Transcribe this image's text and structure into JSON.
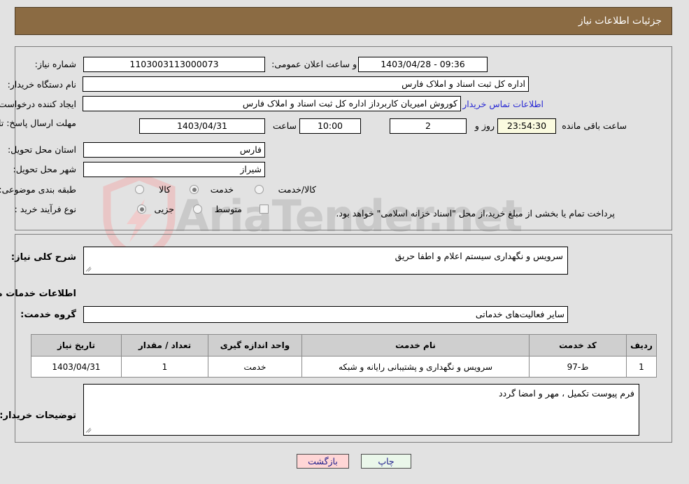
{
  "header": {
    "title": "جزئیات اطلاعات نیاز",
    "bar_color": "#8b6b43"
  },
  "form": {
    "need_number_label": "شماره نیاز:",
    "need_number_value": "1103003113000073",
    "public_announce_label": "تاریخ و ساعت اعلان عمومی:",
    "public_announce_value": "09:36 - 1403/04/28",
    "buyer_org_label": "نام دستگاه خریدار:",
    "buyer_org_value": "اداره کل ثبت اسناد و املاک فارس",
    "requester_label": "ایجاد کننده درخواست:",
    "requester_value": "کوروش امیریان کاربرداز اداره کل ثبت اسناد و املاک فارس",
    "buyer_contact_link": "اطلاعات تماس خریدار",
    "deadline_label": "مهلت ارسال پاسخ: تا تاریخ:",
    "deadline_date": "1403/04/31",
    "hour_label": "ساعت",
    "deadline_time": "10:00",
    "days_remaining": "2",
    "days_word": "روز و",
    "countdown": "23:54:30",
    "countdown_suffix": "ساعت باقی مانده",
    "province_label": "استان محل تحویل:",
    "province_value": "فارس",
    "city_label": "شهر محل تحویل:",
    "city_value": "شیراز",
    "category_label": "طبقه بندی موضوعی:",
    "category_options": [
      "کالا",
      "خدمت",
      "کالا/خدمت"
    ],
    "category_selected": "خدمت",
    "process_label": "نوع فرآیند خرید :",
    "process_options": [
      "جزیی",
      "متوسط"
    ],
    "process_selected": "جزیی",
    "treasury_note": "پرداخت تمام یا بخشی از مبلغ خرید،از محل \"اسناد خزانه اسلامی\" خواهد بود.",
    "treasury_checked": false
  },
  "details": {
    "general_desc_label": "شرح کلی نیاز:",
    "general_desc_value": "سرویس و نگهداری سیستم اعلام و اطفا حریق",
    "services_heading": "اطلاعات خدمات مورد نیاز",
    "service_group_label": "گروه خدمت:",
    "service_group_value": "سایر فعالیت‌های خدماتی",
    "buyer_notes_label": "توضیحات خریدار:",
    "buyer_notes_value": "فرم پیوست تکمیل ، مهر و امضا گردد"
  },
  "table": {
    "columns": [
      "ردیف",
      "کد خدمت",
      "نام خدمت",
      "واحد اندازه گیری",
      "تعداد / مقدار",
      "تاریخ نیاز"
    ],
    "rows": [
      {
        "row": "1",
        "code": "ط-97",
        "name": "سرویس و نگهداری و پشتیبانی رایانه و شبکه",
        "unit": "خدمت",
        "qty": "1",
        "date": "1403/04/31"
      }
    ]
  },
  "footer": {
    "print_label": "چاپ",
    "back_label": "بازگشت"
  },
  "watermark": {
    "text": "AriaTender.net"
  }
}
